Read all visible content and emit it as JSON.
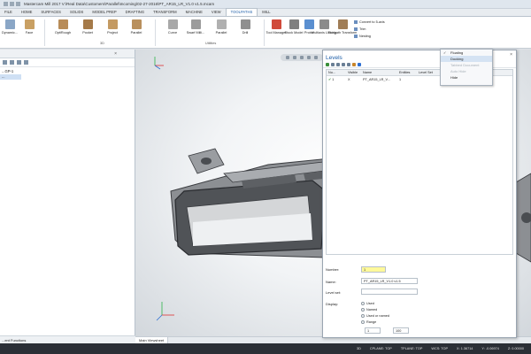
{
  "window": {
    "title": "Mastercam Mill 2017  V:\\Real Data\\Customers\\Parallel\\Incoming\\02-27-2016\\PT_AR15_LR_V1.0 v1.5.mcam"
  },
  "tabs": [
    "FILE",
    "HOME",
    "SURFACES",
    "SOLIDS",
    "MODEL PREP",
    "DRAFTING",
    "TRANSFORM",
    "MACHINE",
    "VIEW",
    "TOOLPATHS",
    "MILL"
  ],
  "active_tab": "TOOLPATHS",
  "ribbon": {
    "buttons_2d": [
      "Dynamic...",
      "Face",
      "OptiRough",
      "Pocket",
      "Project",
      "Parallel"
    ],
    "buttons_3d": [
      "Curve",
      "Swarf Milli...",
      "Parallel",
      "Drill"
    ],
    "buttons_utilities": [
      "Tool Manager",
      "Stock Model",
      "Probe",
      "Multiaxis Linking",
      "Toolpath Transform"
    ],
    "utilities_small": [
      "Convert to 5-axis",
      "Trim",
      "Nesting"
    ],
    "group_2d": "2D",
    "group_3d": "3D",
    "group_utilities": "Utilities"
  },
  "left_panel": {
    "items": [
      "...GP-1",
      "..."
    ],
    "footer": "...ent Functions"
  },
  "viewport": {
    "tab": "Main Viewsheet"
  },
  "levels": {
    "title": "Levels",
    "columns": [
      "Nu...",
      "Visible",
      "Name",
      "Entities",
      "Level Set"
    ],
    "rows": [
      {
        "number": "1",
        "visible": "X",
        "name": "PT_AR15_LR_V...",
        "entities": "1",
        "level_set": ""
      }
    ],
    "form": {
      "number_label": "Number:",
      "number_value": "1",
      "name_label": "Name:",
      "name_value": "PT_AR15_LR_V1.0 v1.5",
      "levelset_label": "Level set:",
      "display_label": "Display:",
      "options": [
        "Used",
        "Named",
        "Used or named",
        "Range"
      ],
      "range_from": "1",
      "range_to": "100"
    }
  },
  "context_menu": {
    "items": [
      "Floating",
      "Docking",
      "Tabbed Document",
      "Auto Hide",
      "Hide"
    ],
    "checked": "Floating",
    "hover": "Docking"
  },
  "statusbar": [
    "3D",
    "CPLANE: TOP",
    "TPLANE: TOP",
    "WCS: TOP",
    "X:  1.36714",
    "Y:  -0.06974",
    "Z:  0.00000"
  ],
  "colors": {
    "accent": "#1d5ea8",
    "statusbar": "#2b2f36",
    "number_highlight": "#fff99a"
  }
}
